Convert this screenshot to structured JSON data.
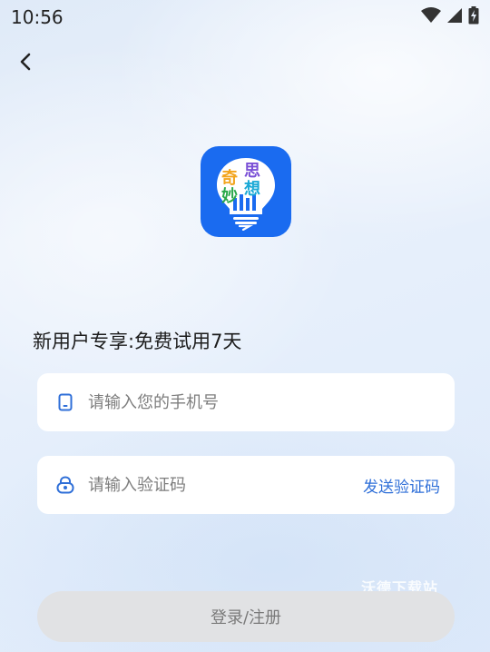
{
  "status_bar": {
    "time": "10:56",
    "icons": [
      "wifi-icon",
      "signal-icon",
      "battery-charging-icon"
    ]
  },
  "nav": {
    "back_icon": "chevron-left-icon"
  },
  "logo": {
    "chars": [
      "奇",
      "思",
      "妙",
      "想"
    ],
    "background_color": "#1a6bf0"
  },
  "promo": {
    "text": "新用户专享:免费试用7天"
  },
  "phone_field": {
    "icon": "phone-icon",
    "placeholder": "请输入您的手机号",
    "value": ""
  },
  "code_field": {
    "icon": "lock-icon",
    "placeholder": "请输入验证码",
    "value": "",
    "send_code_label": "发送验证码"
  },
  "watermark": {
    "text": "沃德下载站"
  },
  "login_button": {
    "label": "登录/注册"
  },
  "colors": {
    "accent": "#2f6fd8",
    "button_disabled": "#e1e2e4"
  }
}
